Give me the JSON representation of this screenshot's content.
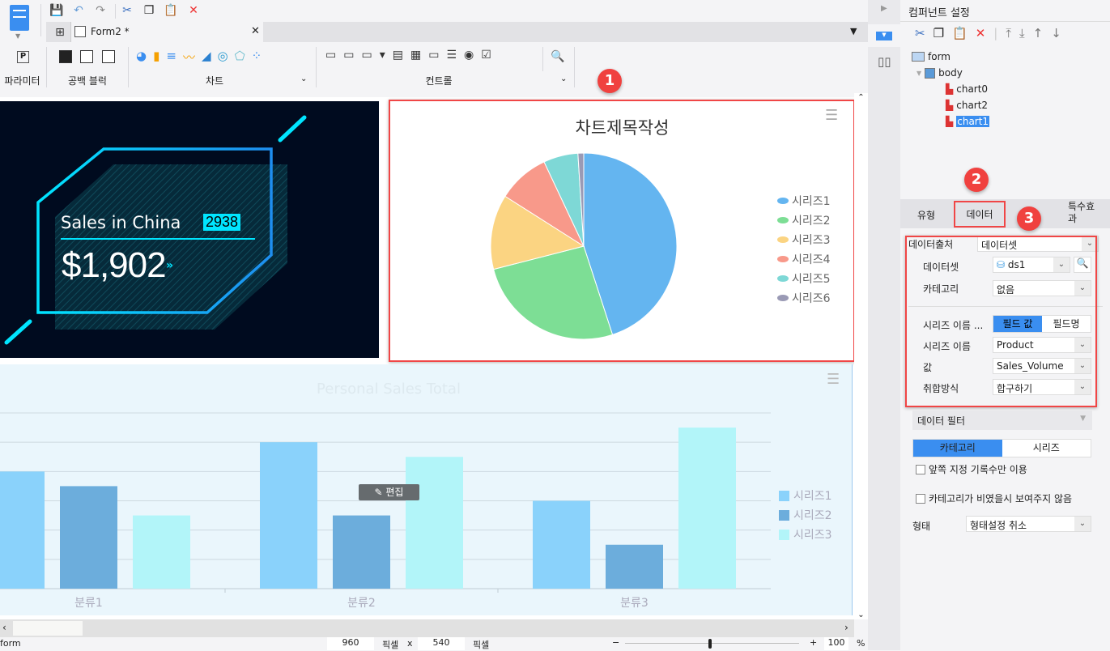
{
  "toolbar": {
    "icons": [
      "save-icon",
      "undo-icon",
      "redo-icon",
      "cut-icon",
      "copy-icon",
      "paste-icon",
      "delete-icon"
    ]
  },
  "tab": {
    "label": "Form2 *"
  },
  "ribbon": {
    "groups": [
      {
        "label": "파라미터"
      },
      {
        "label": "공백 블럭"
      },
      {
        "label": "차트"
      },
      {
        "label": "컨트롤"
      }
    ]
  },
  "kpi": {
    "title": "Sales in China",
    "badge": "2938",
    "value": "$1,902",
    "accent": "#00e5ff",
    "bg": "#000b1f"
  },
  "pie_chart": {
    "chart_data": {
      "type": "pie",
      "title": "차트제목작성",
      "legend_placement": "right",
      "series": [
        {
          "name": "시리즈1",
          "value": 45,
          "color": "#64b5f0"
        },
        {
          "name": "시리즈2",
          "value": 26,
          "color": "#7dde95"
        },
        {
          "name": "시리즈3",
          "value": 13,
          "color": "#fbd482"
        },
        {
          "name": "시리즈4",
          "value": 9,
          "color": "#f8998a"
        },
        {
          "name": "시리즈5",
          "value": 6,
          "color": "#7ed8d6"
        },
        {
          "name": "시리즈6",
          "value": 1,
          "color": "#9a9ab5"
        }
      ]
    }
  },
  "bar_chart": {
    "chart_data": {
      "type": "bar",
      "title": "Personal Sales Total",
      "categories": [
        "분류1",
        "분류2",
        "분류3"
      ],
      "ylim": [
        0,
        6
      ],
      "grid": true,
      "legend_placement": "right",
      "series": [
        {
          "name": "시리즈1",
          "values": [
            4,
            5,
            3
          ],
          "color": "#8ad2fb"
        },
        {
          "name": "시리즈2",
          "values": [
            3.5,
            2.5,
            1.5
          ],
          "color": "#6caddc"
        },
        {
          "name": "시리즈3",
          "values": [
            2.5,
            4.5,
            5.5
          ],
          "color": "#b2f5f9"
        }
      ]
    },
    "edit_label": "편집"
  },
  "panel": {
    "title": "컴퍼넌트 설정",
    "tree": {
      "root": "form",
      "body": "body",
      "children": [
        "chart0",
        "chart2",
        "chart1"
      ],
      "selected": "chart1"
    },
    "tabs": [
      "유형",
      "데이터",
      "특수효과"
    ],
    "data_source": {
      "label": "데이터출처",
      "value": "데이터셋"
    },
    "dataset": {
      "label": "데이터셋",
      "value": "ds1"
    },
    "category": {
      "label": "카테고리",
      "value": "없음"
    },
    "series_name_mode": {
      "label": "시리즈 이름 ...",
      "options": [
        "필드 값",
        "필드명"
      ],
      "selected": "필드 값"
    },
    "series_name": {
      "label": "시리즈 이름",
      "value": "Product"
    },
    "value": {
      "label": "값",
      "value": "Sales_Volume"
    },
    "aggregation": {
      "label": "취합방식",
      "value": "합구하기"
    },
    "data_filter": {
      "label": "데이터 필터",
      "options": [
        "카테고리",
        "시리즈"
      ],
      "selected": "카테고리"
    },
    "check1": {
      "label": "앞쪽 지정 기록수만 이용",
      "checked": false
    },
    "check2": {
      "label": "카테고리가 비였을시 보여주지 않음",
      "checked": false
    },
    "style": {
      "label": "형태",
      "value": "형태설정 취소"
    }
  },
  "badges": [
    "1",
    "2",
    "3"
  ],
  "status": {
    "name": "form",
    "width": "960",
    "unit1": "픽셀",
    "x": "x",
    "height": "540",
    "unit2": "픽셀",
    "zoom": "100",
    "percent": "%"
  }
}
